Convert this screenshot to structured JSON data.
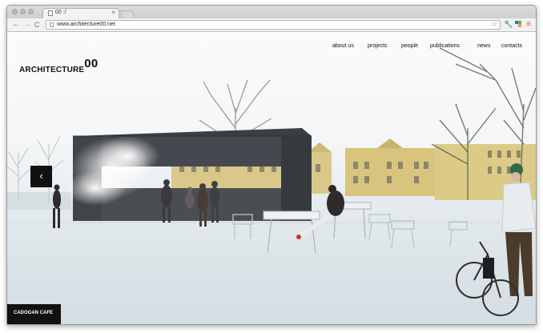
{
  "browser": {
    "tab_title": "00 :/",
    "tab_close": "×",
    "url": "www.architecture00.net",
    "back_glyph": "←",
    "forward_glyph": "→",
    "reload_glyph": "C",
    "star_glyph": "☆",
    "wrench_glyph": "🔧",
    "menu_glyph": "≡"
  },
  "site": {
    "brand_text": "ARCHITECTURE",
    "brand_number": "00",
    "nav": [
      {
        "label": "about us"
      },
      {
        "label": "projects"
      },
      {
        "label": "people"
      },
      {
        "label": "publications"
      },
      {
        "label": "news"
      },
      {
        "label": "contacts"
      }
    ],
    "prev_arrow": "‹",
    "caption": "CADOGAN CAFE"
  },
  "colors": {
    "pavilion": "#3b3f44",
    "buildings": "#d6c37f",
    "ground": "#dde5ea",
    "overlay": "#111111"
  }
}
